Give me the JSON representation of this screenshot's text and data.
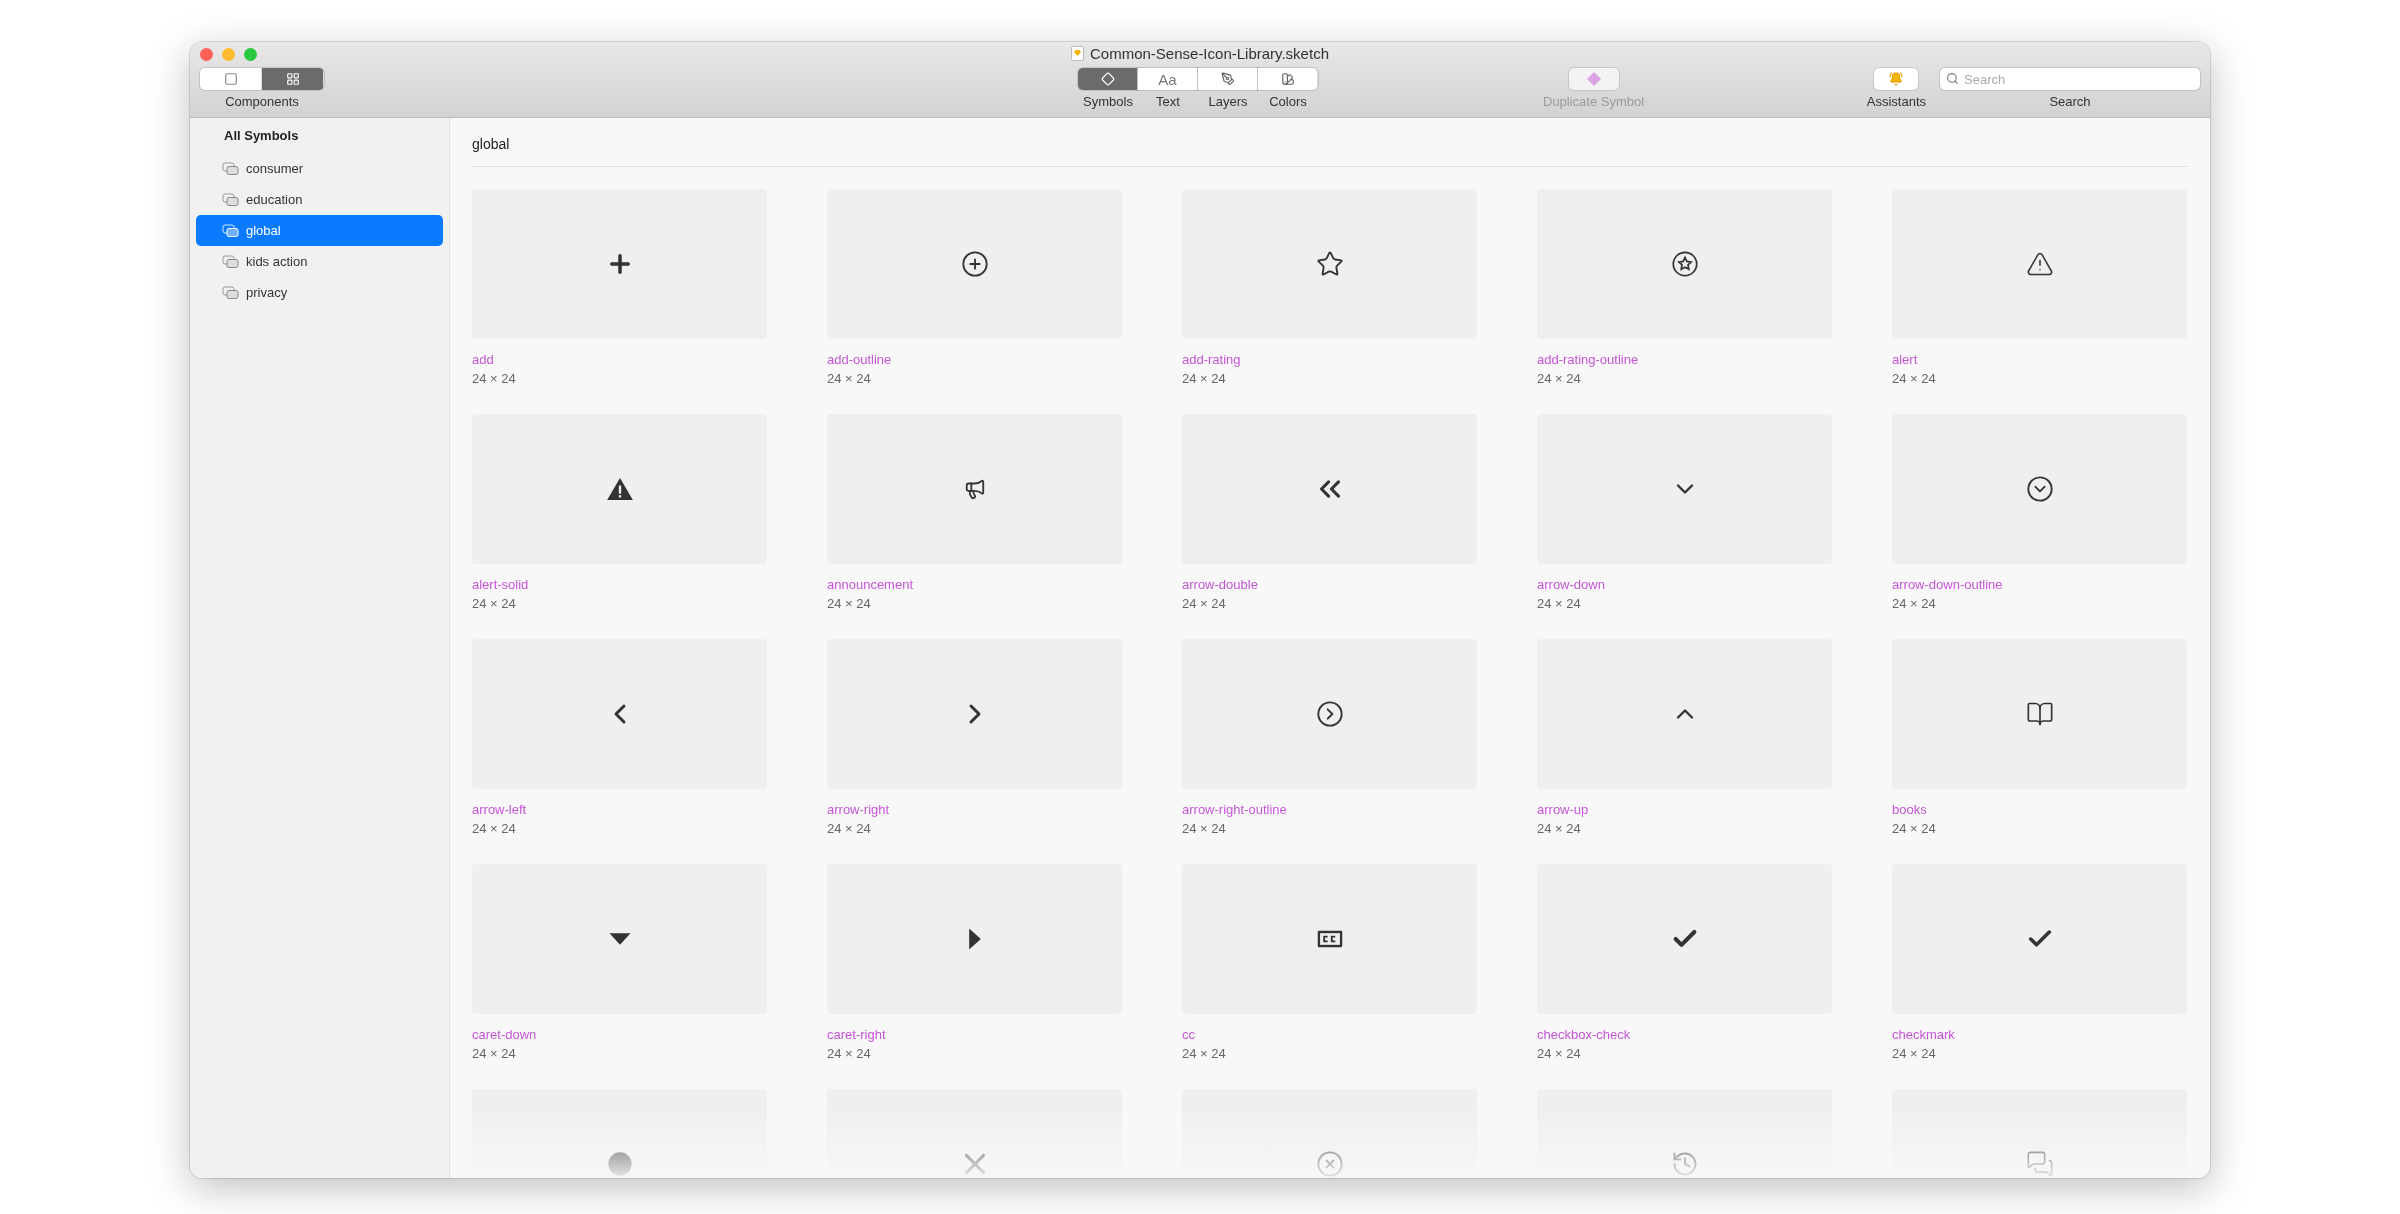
{
  "window": {
    "title": "Common-Sense-Icon-Library.sketch"
  },
  "toolbar": {
    "view_switch": {
      "label": "Components",
      "segments": [
        {
          "selected": false
        },
        {
          "selected": true
        }
      ]
    },
    "inserts": [
      {
        "label": "Symbols",
        "selected": true
      },
      {
        "label": "Text",
        "glyph": "Aa",
        "selected": false
      },
      {
        "label": "Layers",
        "selected": false
      },
      {
        "label": "Colors",
        "selected": false
      }
    ],
    "duplicate": {
      "label": "Duplicate Symbol",
      "disabled": true
    },
    "assistants": {
      "label": "Assistants"
    },
    "search": {
      "placeholder": "Search",
      "label": "Search"
    }
  },
  "sidebar": {
    "heading": "All Symbols",
    "items": [
      {
        "label": "consumer",
        "selected": false
      },
      {
        "label": "education",
        "selected": false
      },
      {
        "label": "global",
        "selected": true
      },
      {
        "label": "kids action",
        "selected": false
      },
      {
        "label": "privacy",
        "selected": false
      }
    ]
  },
  "content": {
    "title": "global",
    "symbols": [
      {
        "kind": "full",
        "name": "add",
        "size": "24 × 24"
      },
      {
        "kind": "full",
        "name": "add-outline",
        "size": "24 × 24"
      },
      {
        "kind": "full",
        "name": "add-rating",
        "size": "24 × 24"
      },
      {
        "kind": "full",
        "name": "add-rating-outline",
        "size": "24 × 24"
      },
      {
        "kind": "full",
        "name": "alert",
        "size": "24 × 24"
      },
      {
        "kind": "full",
        "name": "alert-solid",
        "size": "24 × 24"
      },
      {
        "kind": "full",
        "name": "announcement",
        "size": "24 × 24"
      },
      {
        "kind": "full",
        "name": "arrow-double",
        "size": "24 × 24"
      },
      {
        "kind": "full",
        "name": "arrow-down",
        "size": "24 × 24"
      },
      {
        "kind": "full",
        "name": "arrow-down-outline",
        "size": "24 × 24"
      },
      {
        "kind": "full",
        "name": "arrow-left",
        "size": "24 × 24"
      },
      {
        "kind": "full",
        "name": "arrow-right",
        "size": "24 × 24"
      },
      {
        "kind": "full",
        "name": "arrow-right-outline",
        "size": "24 × 24"
      },
      {
        "kind": "full",
        "name": "arrow-up",
        "size": "24 × 24"
      },
      {
        "kind": "full",
        "name": "books",
        "size": "24 × 24"
      },
      {
        "kind": "full",
        "name": "caret-down",
        "size": "24 × 24"
      },
      {
        "kind": "full",
        "name": "caret-right",
        "size": "24 × 24"
      },
      {
        "kind": "full",
        "name": "cc",
        "size": "24 × 24"
      },
      {
        "kind": "full",
        "name": "checkbox-check",
        "size": "24 × 24"
      },
      {
        "kind": "full",
        "name": "checkmark",
        "size": "24 × 24"
      },
      {
        "kind": "cut"
      },
      {
        "kind": "cut"
      },
      {
        "kind": "cut"
      },
      {
        "kind": "cut"
      },
      {
        "kind": "cut"
      }
    ]
  }
}
